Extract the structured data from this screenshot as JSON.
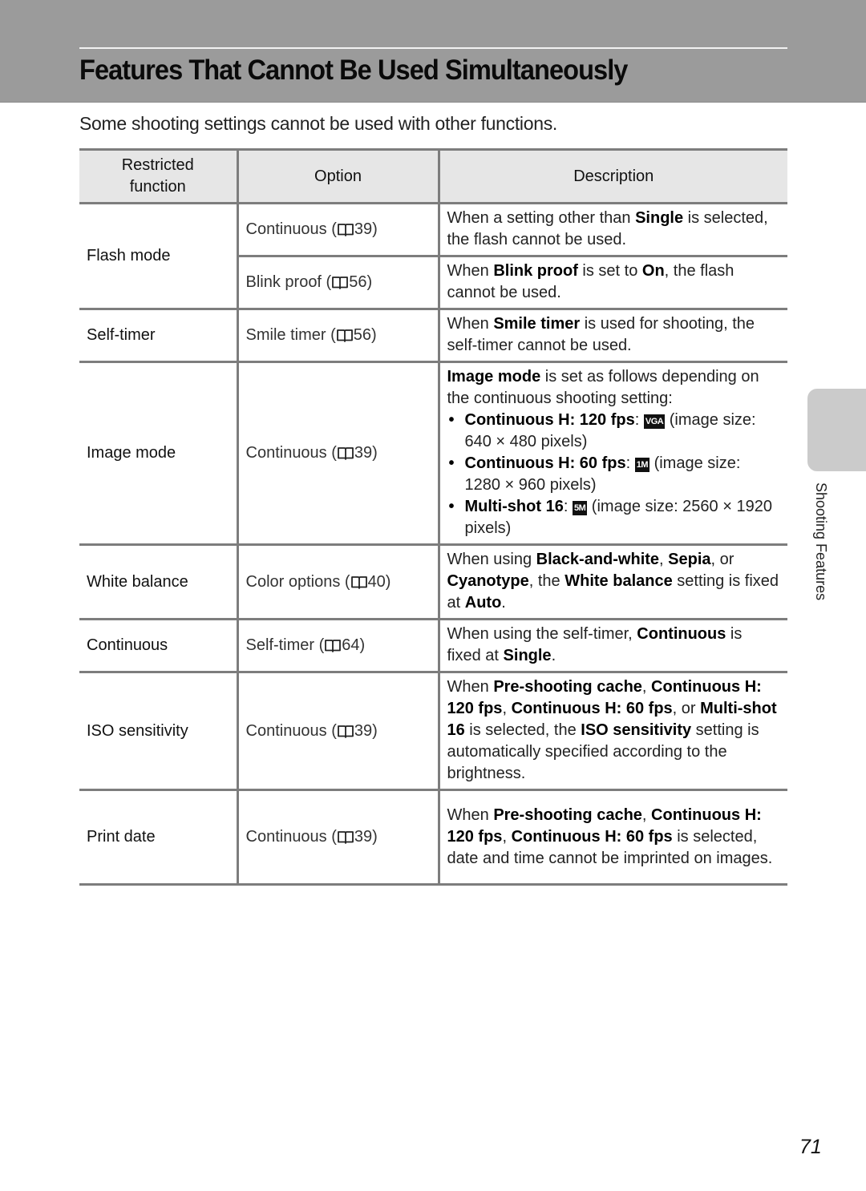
{
  "header": {
    "title": "Features That Cannot Be Used Simultaneously",
    "banner_color": "#9b9b9b"
  },
  "intro": "Some shooting settings cannot be used with other functions.",
  "table": {
    "columns": [
      "Restricted function",
      "Option",
      "Description"
    ],
    "column_header_lines": {
      "restricted_1": "Restricted",
      "restricted_2": "function"
    },
    "rows": [
      {
        "function": "Flash mode",
        "options": [
          {
            "option": "Continuous (",
            "page_ref": "39)",
            "description": [
              {
                "t": "When a setting other than "
              },
              {
                "b": "Single"
              },
              {
                "t": " is selected, the flash cannot be used."
              }
            ]
          },
          {
            "option": "Blink proof (",
            "page_ref": "56)",
            "description": [
              {
                "t": "When "
              },
              {
                "b": "Blink proof"
              },
              {
                "t": " is set to "
              },
              {
                "b": "On"
              },
              {
                "t": ", the flash cannot be used."
              }
            ]
          }
        ]
      },
      {
        "function": "Self-timer",
        "options": [
          {
            "option": "Smile timer (",
            "page_ref": "56)",
            "description": [
              {
                "t": "When "
              },
              {
                "b": "Smile timer"
              },
              {
                "t": " is used for shooting, the self-timer cannot be used."
              }
            ]
          }
        ]
      },
      {
        "function": "Image mode",
        "options": [
          {
            "option": "Continuous (",
            "page_ref": "39)",
            "description": [
              {
                "b": "Image mode"
              },
              {
                "t": " is set as follows depending on the continuous shooting setting:"
              }
            ],
            "bullets": [
              {
                "label": "Continuous H: 120 fps",
                "icon": "VGA",
                "icon_name": "image-size-vga-icon",
                "text": " (image size: 640 × 480 pixels)"
              },
              {
                "label": "Continuous H: 60 fps",
                "icon": "1M",
                "icon_name": "image-size-1m-icon",
                "text": " (image size: 1280 × 960 pixels)"
              },
              {
                "label": "Multi-shot 16",
                "icon": "5M",
                "icon_name": "image-size-5m-icon",
                "text": " (image size: 2560 × 1920 pixels)"
              }
            ]
          }
        ]
      },
      {
        "function": "White balance",
        "options": [
          {
            "option": "Color options (",
            "page_ref": "40)",
            "description": [
              {
                "t": "When using "
              },
              {
                "b": "Black-and-white"
              },
              {
                "t": ", "
              },
              {
                "b": "Sepia"
              },
              {
                "t": ", or "
              },
              {
                "b": "Cyanotype"
              },
              {
                "t": ", the "
              },
              {
                "b": "White balance"
              },
              {
                "t": " setting is fixed at "
              },
              {
                "b": "Auto"
              },
              {
                "t": "."
              }
            ]
          }
        ]
      },
      {
        "function": "Continuous",
        "options": [
          {
            "option": "Self-timer (",
            "page_ref": "64)",
            "description": [
              {
                "t": "When using the self-timer, "
              },
              {
                "b": "Continuous"
              },
              {
                "t": " is fixed at "
              },
              {
                "b": "Single"
              },
              {
                "t": "."
              }
            ]
          }
        ]
      },
      {
        "function": "ISO sensitivity",
        "options": [
          {
            "option": "Continuous (",
            "page_ref": "39)",
            "description": [
              {
                "t": "When "
              },
              {
                "b": "Pre-shooting cache"
              },
              {
                "t": ", "
              },
              {
                "b": "Continuous H: 120 fps"
              },
              {
                "t": ", "
              },
              {
                "b": "Continuous H: 60 fps"
              },
              {
                "t": ", or "
              },
              {
                "b": "Multi-shot 16"
              },
              {
                "t": " is selected, the "
              },
              {
                "b": "ISO sensitivity"
              },
              {
                "t": " setting is automatically specified according to the brightness."
              }
            ]
          }
        ]
      },
      {
        "function": "Print date",
        "options": [
          {
            "option": "Continuous (",
            "page_ref": "39)",
            "description": [
              {
                "t": "When "
              },
              {
                "b": "Pre-shooting cache"
              },
              {
                "t": ", "
              },
              {
                "b": "Continuous H: 120 fps"
              },
              {
                "t": ", "
              },
              {
                "b": "Continuous H: 60 fps"
              },
              {
                "t": " is selected, date and time cannot be imprinted on images."
              }
            ]
          }
        ]
      }
    ]
  },
  "side_tab": {
    "label": "Shooting Features",
    "color": "#cbcbcb"
  },
  "page_number": "71"
}
